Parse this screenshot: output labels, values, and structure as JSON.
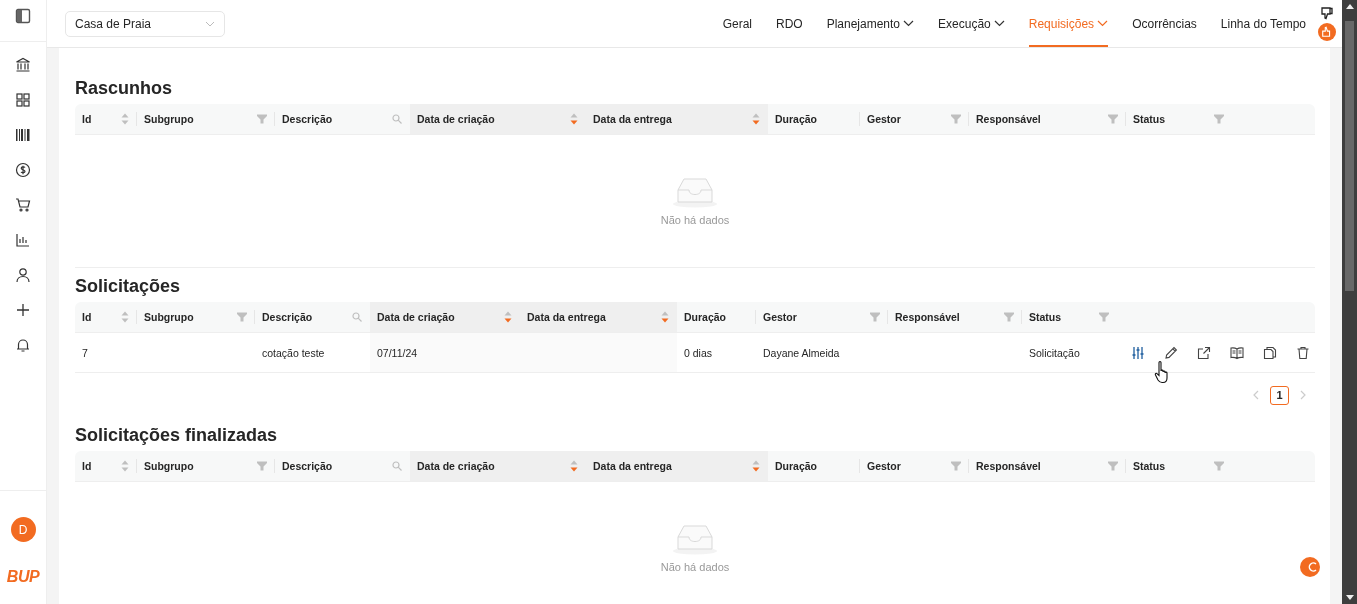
{
  "project_select": {
    "value": "Casa de Praia"
  },
  "tabs": [
    {
      "label": "Geral",
      "selected": false,
      "dropdown": false
    },
    {
      "label": "RDO",
      "selected": false,
      "dropdown": false
    },
    {
      "label": "Planejamento",
      "selected": false,
      "dropdown": true
    },
    {
      "label": "Execução",
      "selected": false,
      "dropdown": true
    },
    {
      "label": "Requisições",
      "selected": true,
      "dropdown": true
    },
    {
      "label": "Ocorrências",
      "selected": false,
      "dropdown": false
    },
    {
      "label": "Linha do Tempo",
      "selected": false,
      "dropdown": false
    }
  ],
  "user": {
    "initial": "D"
  },
  "logo": {
    "text": "BUP"
  },
  "sections": [
    {
      "title": "Rascunhos",
      "table": {
        "columns": [
          {
            "label": "Id",
            "kind": "sort",
            "sorted": false
          },
          {
            "label": "Subgrupo",
            "kind": "filter"
          },
          {
            "label": "Descrição",
            "kind": "search"
          },
          {
            "label": "Data de criação",
            "kind": "sort",
            "sorted": true
          },
          {
            "label": "Data da entrega",
            "kind": "sort",
            "sorted": true
          },
          {
            "label": "Duração",
            "kind": "plain"
          },
          {
            "label": "Gestor",
            "kind": "filter"
          },
          {
            "label": "Responsável",
            "kind": "filter"
          },
          {
            "label": "Status",
            "kind": "filter"
          }
        ],
        "empty_text": "Não há dados"
      }
    },
    {
      "title": "Solicitações",
      "table": {
        "columns": [
          {
            "label": "Id",
            "kind": "sort",
            "sorted": false
          },
          {
            "label": "Subgrupo",
            "kind": "filter"
          },
          {
            "label": "Descrição",
            "kind": "search"
          },
          {
            "label": "Data de criação",
            "kind": "sort",
            "sorted": true
          },
          {
            "label": "Data da entrega",
            "kind": "sort",
            "sorted": true
          },
          {
            "label": "Duração",
            "kind": "plain"
          },
          {
            "label": "Gestor",
            "kind": "filter"
          },
          {
            "label": "Responsável",
            "kind": "filter"
          },
          {
            "label": "Status",
            "kind": "filter"
          }
        ],
        "rows": [
          {
            "cells": [
              "7",
              null,
              "cotação teste",
              "07/11/24",
              null,
              "0 dias",
              "Dayane Almeida",
              null,
              "Solicitação"
            ]
          }
        ],
        "pages": [
          {
            "label": "1",
            "selected": true
          }
        ]
      }
    },
    {
      "title": "Solicitações finalizadas",
      "table": {
        "columns": [
          {
            "label": "Id",
            "kind": "sort",
            "sorted": false
          },
          {
            "label": "Subgrupo",
            "kind": "filter"
          },
          {
            "label": "Descrição",
            "kind": "search"
          },
          {
            "label": "Data de criação",
            "kind": "sort",
            "sorted": true
          },
          {
            "label": "Data da entrega",
            "kind": "sort",
            "sorted": true
          },
          {
            "label": "Duração",
            "kind": "plain"
          },
          {
            "label": "Gestor",
            "kind": "filter"
          },
          {
            "label": "Responsável",
            "kind": "filter"
          },
          {
            "label": "Status",
            "kind": "filter"
          }
        ],
        "empty_text": "Não há dados"
      }
    }
  ]
}
